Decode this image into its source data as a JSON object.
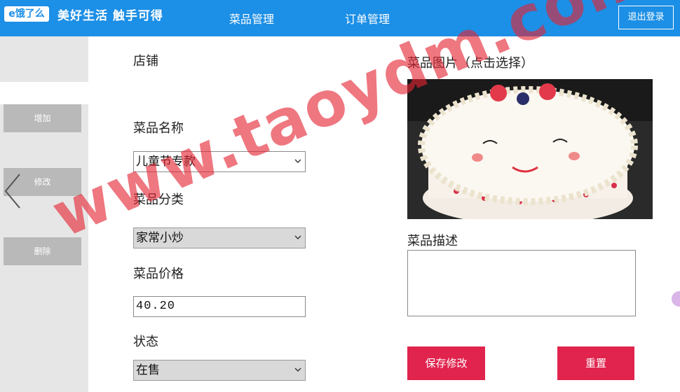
{
  "header": {
    "logo_text": "e饿了么",
    "slogan": "美好生活 触手可得",
    "nav": [
      "菜品管理",
      "订单管理"
    ],
    "logout_label": "退出登录"
  },
  "sidebar": {
    "buttons": [
      "增加",
      "修改",
      "删除"
    ]
  },
  "form": {
    "shop_label": "店铺",
    "dish_name_label": "菜品名称",
    "dish_name_value": "儿童节专款",
    "category_label": "菜品分类",
    "category_value": "家常小炒",
    "price_label": "菜品价格",
    "price_value": "40.20",
    "status_label": "状态",
    "status_value": "在售",
    "image_label": "菜品图片（点击选择）",
    "description_label": "菜品描述",
    "description_value": "",
    "save_label": "保存修改",
    "reset_label": "重置"
  },
  "watermark": "www.taoydm.com",
  "colors": {
    "header_blue": "#1c8fe6",
    "button_red": "#e0244e",
    "sidebar_gray": "#e6e6e6",
    "side_button_gray": "#b9b9b9"
  },
  "icons": [
    "chevron-left-icon",
    "chevron-down-icon"
  ]
}
